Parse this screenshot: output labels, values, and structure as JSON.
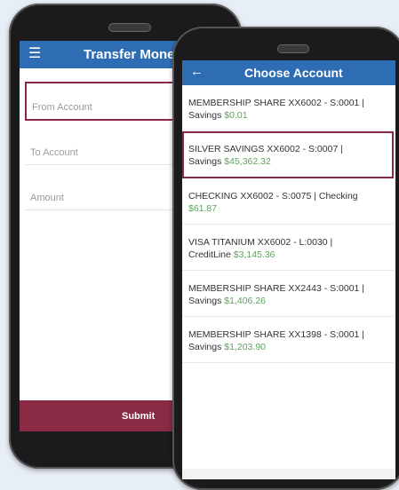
{
  "back_screen": {
    "title": "Transfer Money",
    "fields": [
      {
        "label": "From Account"
      },
      {
        "label": "To Account"
      },
      {
        "label": "Amount"
      }
    ],
    "submit_label": "Submit"
  },
  "front_screen": {
    "title": "Choose Account",
    "accounts": [
      {
        "name": "MEMBERSHIP SHARE XX6002 - S:0001 |",
        "type": "Savings",
        "balance": "$0.01"
      },
      {
        "name": "SILVER SAVINGS XX6002 - S:0007 |",
        "type": "Savings",
        "balance": "$45,362.32"
      },
      {
        "name": "CHECKING XX6002 - S:0075 | Checking",
        "type": "",
        "balance": "$61.87"
      },
      {
        "name": "VISA TITANIUM XX6002 - L:0030 |",
        "type": "CreditLine",
        "balance": "$3,145.36"
      },
      {
        "name": "MEMBERSHIP SHARE XX2443 - S:0001 |",
        "type": "Savings",
        "balance": "$1,406.26"
      },
      {
        "name": "MEMBERSHIP SHARE XX1398 - S:0001 |",
        "type": "Savings",
        "balance": "$1,203.90"
      }
    ],
    "selected_index": 1
  },
  "colors": {
    "header": "#2e6db4",
    "accent": "#8a2a45",
    "balance": "#5aa55a"
  },
  "icons": {
    "menu": "hamburger-menu-icon",
    "back": "back-arrow-icon"
  }
}
